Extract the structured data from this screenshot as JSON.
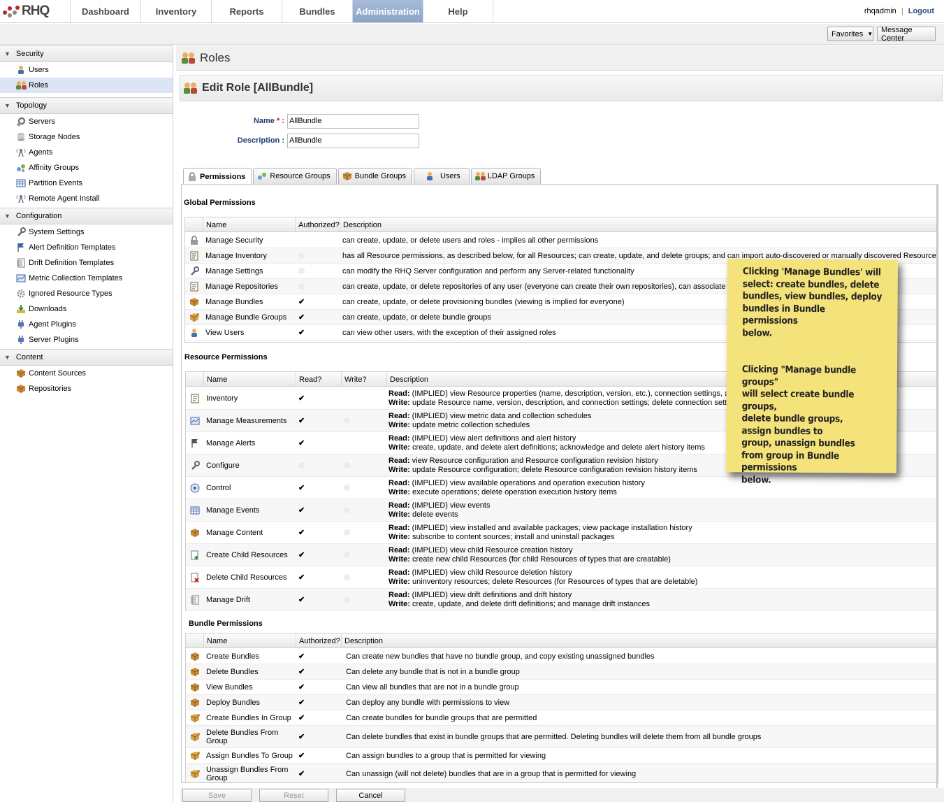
{
  "app": {
    "logo": "RHQ"
  },
  "nav": {
    "items": [
      {
        "label": "Dashboard"
      },
      {
        "label": "Inventory"
      },
      {
        "label": "Reports"
      },
      {
        "label": "Bundles"
      },
      {
        "label": "Administration"
      },
      {
        "label": "Help"
      }
    ],
    "active": "Administration"
  },
  "user": {
    "name": "rhqadmin",
    "sep": "|",
    "logout": "Logout"
  },
  "toolbar": {
    "favorites": "Favorites",
    "message_center": "Message Center"
  },
  "sidebar": {
    "sections": [
      {
        "title": "Security",
        "items": [
          "Users",
          "Roles"
        ]
      },
      {
        "title": "Topology",
        "items": [
          "Servers",
          "Storage Nodes",
          "Agents",
          "Affinity Groups",
          "Partition Events",
          "Remote Agent Install"
        ]
      },
      {
        "title": "Configuration",
        "items": [
          "System Settings",
          "Alert Definition Templates",
          "Drift Definition Templates",
          "Metric Collection Templates",
          "Ignored Resource Types",
          "Downloads",
          "Agent Plugins",
          "Server Plugins"
        ]
      },
      {
        "title": "Content",
        "items": [
          "Content Sources",
          "Repositories"
        ]
      }
    ],
    "selected": "Roles"
  },
  "page": {
    "title": "Roles",
    "edit_title": "Edit Role [AllBundle]"
  },
  "form": {
    "name_label": "Name",
    "required_mark": "*",
    "colon": ":",
    "name_value": "AllBundle",
    "description_label": "Description :",
    "description_value": "AllBundle"
  },
  "tabs": [
    "Permissions",
    "Resource Groups",
    "Bundle Groups",
    "Users",
    "LDAP Groups"
  ],
  "global": {
    "title": "Global Permissions",
    "headers": [
      "Name",
      "Authorized?",
      "Description"
    ],
    "rows": [
      {
        "name": "Manage Security",
        "auth": "none",
        "desc": "can create, update, or delete users and roles - implies all other permissions"
      },
      {
        "name": "Manage Inventory",
        "auth": "off",
        "desc": "has all Resource permissions, as described below, for all Resources; can create, update, and delete groups; and can import auto-discovered or manually discovered Resources"
      },
      {
        "name": "Manage Settings",
        "auth": "off",
        "desc": "can modify the RHQ Server configuration and perform any Server-related functionality"
      },
      {
        "name": "Manage Repositories",
        "auth": "off",
        "desc": "can create, update, or delete repositories of any user (everyone can create their own repositories), can associate co"
      },
      {
        "name": "Manage Bundles",
        "auth": "on",
        "desc": "can create, update, or delete provisioning bundles (viewing is implied for everyone)"
      },
      {
        "name": "Manage Bundle Groups",
        "auth": "on",
        "desc": "can create, update, or delete bundle groups"
      },
      {
        "name": "View Users",
        "auth": "on",
        "desc": "can view other users, with the exception of their assigned roles"
      }
    ]
  },
  "resource": {
    "title": "Resource Permissions",
    "headers": [
      "Name",
      "Read?",
      "Write?",
      "Description"
    ],
    "read_label": "Read:",
    "write_label": "Write:",
    "rows": [
      {
        "name": "Inventory",
        "read": "on",
        "write": "none",
        "r": " (IMPLIED) view Resource properties (name, description, version, etc.), connection settings, an",
        "w": " update Resource name, version, description, and connection settings; delete connection settin"
      },
      {
        "name": "Manage Measurements",
        "read": "on",
        "write": "off",
        "r": " (IMPLIED) view metric data and collection schedules",
        "w": " update metric collection schedules"
      },
      {
        "name": "Manage Alerts",
        "read": "on",
        "write": "none",
        "r": " (IMPLIED) view alert definitions and alert history",
        "w": " create, update, and delete alert definitions; acknowledge and delete alert history items"
      },
      {
        "name": "Configure",
        "read": "off",
        "write": "off",
        "r": " view Resource configuration and Resource configuration revision history",
        "w": " update Resource configuration; delete Resource configuration revision history items"
      },
      {
        "name": "Control",
        "read": "on",
        "write": "off",
        "r": " (IMPLIED) view available operations and operation execution history",
        "w": " execute operations; delete operation execution history items"
      },
      {
        "name": "Manage Events",
        "read": "on",
        "write": "off",
        "r": " (IMPLIED) view events",
        "w": " delete events"
      },
      {
        "name": "Manage Content",
        "read": "on",
        "write": "off",
        "r": " (IMPLIED) view installed and available packages; view package installation history",
        "w": " subscribe to content sources; install and uninstall packages"
      },
      {
        "name": "Create Child Resources",
        "read": "on",
        "write": "off",
        "r": " (IMPLIED) view child Resource creation history",
        "w": " create new child Resources (for child Resources of types that are creatable)"
      },
      {
        "name": "Delete Child Resources",
        "read": "on",
        "write": "off",
        "r": " (IMPLIED) view child Resource deletion history",
        "w": " uninventory resources; delete Resources (for Resources of types that are deletable)"
      },
      {
        "name": "Manage Drift",
        "read": "on",
        "write": "off",
        "r": " (IMPLIED) view drift definitions and drift history",
        "w": " create, update, and delete drift definitions; and manage drift instances"
      }
    ]
  },
  "bundle": {
    "title": "Bundle Permissions",
    "headers": [
      "Name",
      "Authorized?",
      "Description"
    ],
    "rows": [
      {
        "name": "Create Bundles",
        "auth": "on",
        "desc": "Can create new bundles that have no bundle group, and copy existing unassigned bundles"
      },
      {
        "name": "Delete Bundles",
        "auth": "on",
        "desc": "Can delete any bundle that is not in a bundle group"
      },
      {
        "name": "View Bundles",
        "auth": "on",
        "desc": "Can view all bundles that are not in a bundle group"
      },
      {
        "name": "Deploy Bundles",
        "auth": "on",
        "desc": "Can deploy any bundle with permissions to view"
      },
      {
        "name": "Create Bundles In Group",
        "auth": "on",
        "desc": "Can create bundles for bundle groups that are permitted"
      },
      {
        "name": "Delete Bundles From Group",
        "auth": "on",
        "desc": "Can delete bundles that exist in bundle groups that are permitted.  Deleting bundles will delete them from all bundle groups"
      },
      {
        "name": "Assign Bundles To Group",
        "auth": "on",
        "desc": "Can assign bundles to a group that is permitted for viewing"
      },
      {
        "name": "Unassign Bundles From Group",
        "auth": "on",
        "desc": "Can unassign (will not delete) bundles that are in a group that is permitted for viewing"
      }
    ]
  },
  "buttons": {
    "save": "Save",
    "reset": "Reset",
    "cancel": "Cancel"
  },
  "note": {
    "p1": "Clicking 'Manage Bundles' will\nselect:  create bundles, delete\nbundles, view bundles, deploy\nbundles in Bundle permissions\nbelow.",
    "p2": "Clicking \"Manage bundle groups\"\nwill select create bundle groups,\ndelete bundle groups,\nassign bundles to\ngroup, unassign bundles\nfrom group in Bundle permissions\nbelow.",
    "color": "#f4e27a"
  },
  "colors": {
    "accent": "#8aa4c8",
    "label": "#1f3d73",
    "selected": "#dbe5f3"
  }
}
